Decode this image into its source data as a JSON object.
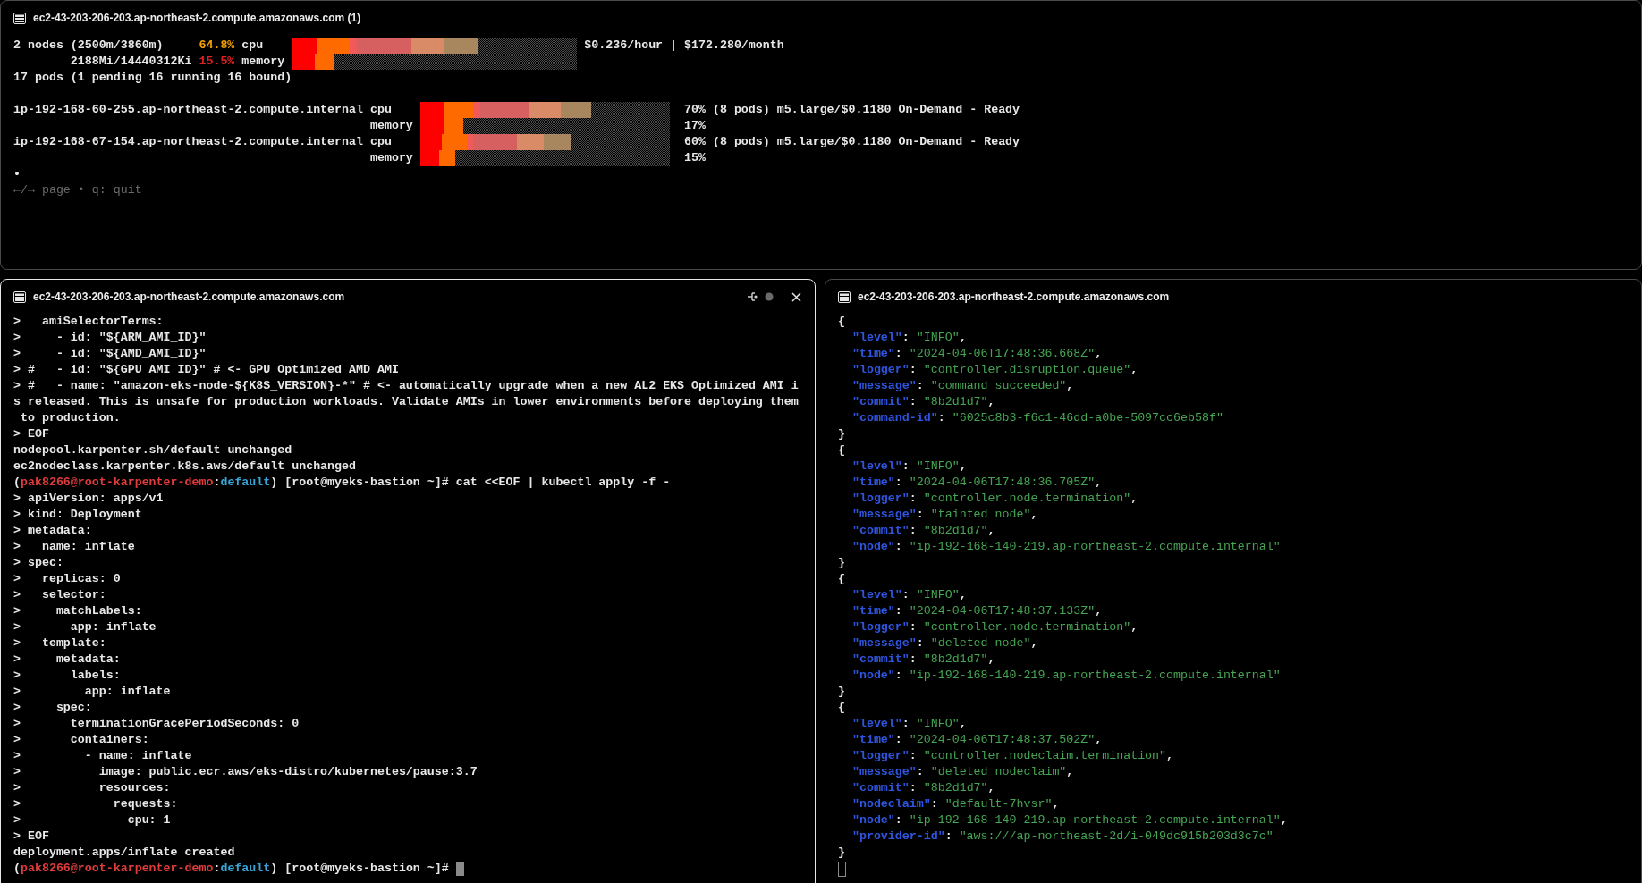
{
  "top_pane": {
    "title": "ec2-43-203-206-203.ap-northeast-2.compute.amazonaws.com (1)",
    "active": false,
    "summary": [
      {
        "kind": "cpu",
        "label": "2 nodes (2500m/3860m)",
        "percent": "64.8%",
        "color": "#f5a000",
        "resource": "cpu",
        "level": 0.654,
        "note": "$0.236/hour | $172.280/month"
      },
      {
        "kind": "memory",
        "label": "2188Mi/14440312Ki",
        "percent": "15.5%",
        "color": "#e02020",
        "resource": "memory",
        "level": 0.151
      }
    ],
    "pods": "17 pods (1 pending 16 running 16 bound)",
    "nodes": [
      {
        "name": "ip-192-168-60-255.ap-northeast-2.compute.internal",
        "rows": [
          {
            "kind": "cpu",
            "resource": "cpu",
            "level": 0.686,
            "note": "70% (8 pods) m5.large/$0.1180 On-Demand - Ready"
          },
          {
            "kind": "memory",
            "resource": "memory",
            "level": 0.172,
            "note": "17%"
          }
        ]
      },
      {
        "name": "ip-192-168-67-154.ap-northeast-2.compute.internal",
        "rows": [
          {
            "kind": "cpu",
            "resource": "cpu",
            "level": 0.602,
            "note": "60% (8 pods) m5.large/$0.1180 On-Demand - Ready"
          },
          {
            "kind": "memory",
            "resource": "memory",
            "level": 0.142,
            "note": "15%"
          }
        ]
      }
    ],
    "bullet": "•",
    "hint": "←/→ page • q: quit"
  },
  "left_pane": {
    "title": "ec2-43-203-206-203.ap-northeast-2.compute.amazonaws.com",
    "active": true,
    "lines": [
      ">   amiSelectorTerms:",
      ">     - id: \"${ARM_AMI_ID}\"",
      ">     - id: \"${AMD_AMI_ID}\"",
      "> #   - id: \"${GPU_AMI_ID}\" # <- GPU Optimized AMD AMI",
      "> #   - name: \"amazon-eks-node-${K8S_VERSION}-*\" # <- automatically upgrade when a new AL2 EKS Optimized AMI i",
      "s released. This is unsafe for production workloads. Validate AMIs in lower environments before deploying them",
      " to production.",
      "> EOF",
      "nodepool.karpenter.sh/default unchanged",
      "ec2nodeclass.karpenter.k8s.aws/default unchanged",
      {
        "kind": "prompt",
        "cursor": false,
        "parts": [
          {
            "text": "(",
            "color": "#e8e8e8"
          },
          {
            "text": "pak8266@root-karpenter-demo",
            "color": "#e03c3c"
          },
          {
            "text": ":",
            "color": "#e8e8e8"
          },
          {
            "text": "default",
            "color": "#3aa6d8"
          },
          {
            "text": ") [root@myeks-bastion ~]# cat <<EOF | kubectl apply -f -",
            "color": "#e8e8e8"
          }
        ]
      },
      "> apiVersion: apps/v1",
      "> kind: Deployment",
      "> metadata:",
      ">   name: inflate",
      "> spec:",
      ">   replicas: 0",
      ">   selector:",
      ">     matchLabels:",
      ">       app: inflate",
      ">   template:",
      ">     metadata:",
      ">       labels:",
      ">         app: inflate",
      ">     spec:",
      ">       terminationGracePeriodSeconds: 0",
      ">       containers:",
      ">         - name: inflate",
      ">           image: public.ecr.aws/eks-distro/kubernetes/pause:3.7",
      ">           resources:",
      ">             requests:",
      ">               cpu: 1",
      "> EOF",
      "deployment.apps/inflate created",
      {
        "kind": "prompt",
        "cursor": true,
        "parts": [
          {
            "text": "(",
            "color": "#e8e8e8"
          },
          {
            "text": "pak8266@root-karpenter-demo",
            "color": "#e03c3c"
          },
          {
            "text": ":",
            "color": "#e8e8e8"
          },
          {
            "text": "default",
            "color": "#3aa6d8"
          },
          {
            "text": ") [root@myeks-bastion ~]#",
            "color": "#e8e8e8"
          }
        ]
      }
    ]
  },
  "right_pane": {
    "title": "ec2-43-203-206-203.ap-northeast-2.compute.amazonaws.com",
    "active": false,
    "lines": [
      {
        "kind": "brace",
        "text": "{"
      },
      {
        "kind": "field",
        "key": "\"level\"",
        "colon": ":",
        "value": "\"INFO\"",
        "comma": ","
      },
      {
        "kind": "field",
        "key": "\"time\"",
        "colon": ":",
        "value": "\"2024-04-06T17:48:36.668Z\"",
        "comma": ","
      },
      {
        "kind": "field",
        "key": "\"logger\"",
        "colon": ":",
        "value": "\"controller.disruption.queue\"",
        "comma": ","
      },
      {
        "kind": "field",
        "key": "\"message\"",
        "colon": ":",
        "value": "\"command succeeded\"",
        "comma": ","
      },
      {
        "kind": "field",
        "key": "\"commit\"",
        "colon": ":",
        "value": "\"8b2d1d7\"",
        "comma": ","
      },
      {
        "kind": "field",
        "key": "\"command-id\"",
        "colon": ":",
        "value": "\"6025c8b3-f6c1-46dd-a0be-5097cc6eb58f\""
      },
      {
        "kind": "brace",
        "text": "}"
      },
      {
        "kind": "brace",
        "text": "{"
      },
      {
        "kind": "field",
        "key": "\"level\"",
        "colon": ":",
        "value": "\"INFO\"",
        "comma": ","
      },
      {
        "kind": "field",
        "key": "\"time\"",
        "colon": ":",
        "value": "\"2024-04-06T17:48:36.705Z\"",
        "comma": ","
      },
      {
        "kind": "field",
        "key": "\"logger\"",
        "colon": ":",
        "value": "\"controller.node.termination\"",
        "comma": ","
      },
      {
        "kind": "field",
        "key": "\"message\"",
        "colon": ":",
        "value": "\"tainted node\"",
        "comma": ","
      },
      {
        "kind": "field",
        "key": "\"commit\"",
        "colon": ":",
        "value": "\"8b2d1d7\"",
        "comma": ","
      },
      {
        "kind": "field",
        "key": "\"node\"",
        "colon": ":",
        "value": "\"ip-192-168-140-219.ap-northeast-2.compute.internal\""
      },
      {
        "kind": "brace",
        "text": "}"
      },
      {
        "kind": "brace",
        "text": "{"
      },
      {
        "kind": "field",
        "key": "\"level\"",
        "colon": ":",
        "value": "\"INFO\"",
        "comma": ","
      },
      {
        "kind": "field",
        "key": "\"time\"",
        "colon": ":",
        "value": "\"2024-04-06T17:48:37.133Z\"",
        "comma": ","
      },
      {
        "kind": "field",
        "key": "\"logger\"",
        "colon": ":",
        "value": "\"controller.node.termination\"",
        "comma": ","
      },
      {
        "kind": "field",
        "key": "\"message\"",
        "colon": ":",
        "value": "\"deleted node\"",
        "comma": ","
      },
      {
        "kind": "field",
        "key": "\"commit\"",
        "colon": ":",
        "value": "\"8b2d1d7\"",
        "comma": ","
      },
      {
        "kind": "field",
        "key": "\"node\"",
        "colon": ":",
        "value": "\"ip-192-168-140-219.ap-northeast-2.compute.internal\""
      },
      {
        "kind": "brace",
        "text": "}"
      },
      {
        "kind": "brace",
        "text": "{"
      },
      {
        "kind": "field",
        "key": "\"level\"",
        "colon": ":",
        "value": "\"INFO\"",
        "comma": ","
      },
      {
        "kind": "field",
        "key": "\"time\"",
        "colon": ":",
        "value": "\"2024-04-06T17:48:37.502Z\"",
        "comma": ","
      },
      {
        "kind": "field",
        "key": "\"logger\"",
        "colon": ":",
        "value": "\"controller.nodeclaim.termination\"",
        "comma": ","
      },
      {
        "kind": "field",
        "key": "\"message\"",
        "colon": ":",
        "value": "\"deleted nodeclaim\"",
        "comma": ","
      },
      {
        "kind": "field",
        "key": "\"commit\"",
        "colon": ":",
        "value": "\"8b2d1d7\"",
        "comma": ","
      },
      {
        "kind": "field",
        "key": "\"nodeclaim\"",
        "colon": ":",
        "value": "\"default-7hvsr\"",
        "comma": ","
      },
      {
        "kind": "field",
        "key": "\"node\"",
        "colon": ":",
        "value": "\"ip-192-168-140-219.ap-northeast-2.compute.internal\"",
        "comma": ","
      },
      {
        "kind": "field",
        "key": "\"provider-id\"",
        "colon": ":",
        "value": "\"aws:///ap-northeast-2d/i-049dc915b203d3c7c\""
      },
      {
        "kind": "brace",
        "text": "}"
      },
      {
        "kind": "cursor"
      }
    ]
  }
}
